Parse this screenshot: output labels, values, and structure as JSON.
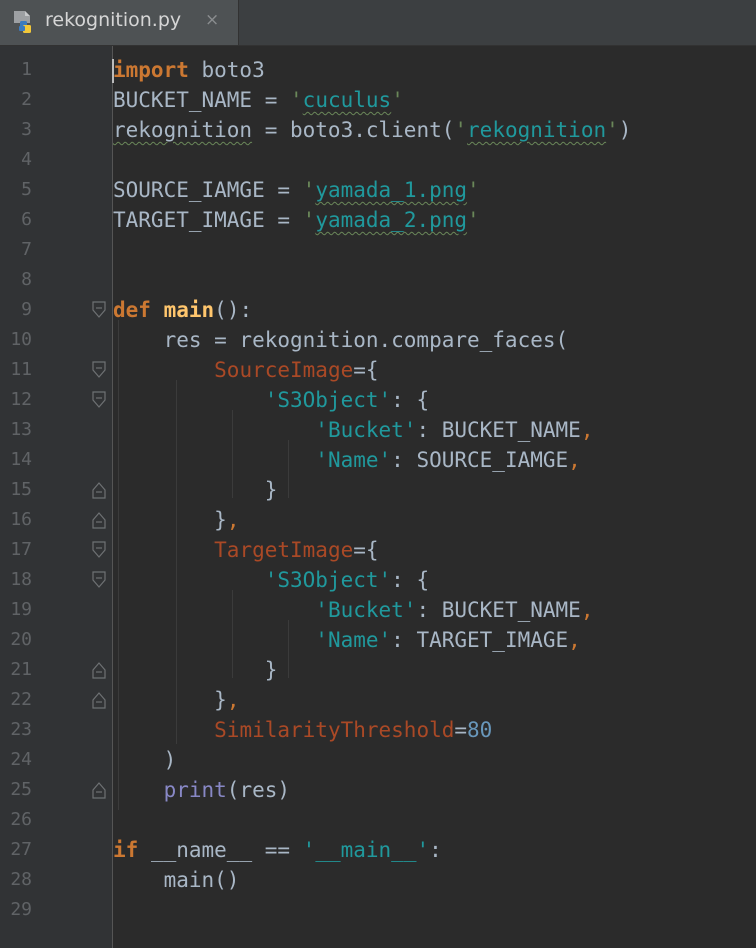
{
  "tab": {
    "filename": "rekognition.py",
    "close_glyph": "×",
    "icon": "python-file-icon"
  },
  "colors": {
    "background": "#2b2b2b",
    "gutter": "#313335",
    "keyword": "#cc7832",
    "string": "#6a8759",
    "parameter": "#aa4926",
    "number": "#6897bb",
    "builtin": "#8888c6",
    "line_number": "#606366",
    "text": "#a9b7c6"
  },
  "gutter": {
    "line_numbers": [
      "1",
      "2",
      "3",
      "4",
      "5",
      "6",
      "7",
      "8",
      "9",
      "10",
      "11",
      "12",
      "13",
      "14",
      "15",
      "16",
      "17",
      "18",
      "19",
      "20",
      "21",
      "22",
      "23",
      "24",
      "25",
      "26",
      "27",
      "28",
      "29"
    ]
  },
  "code": {
    "l1": {
      "kw": "import",
      "rest": " boto3"
    },
    "l2": {
      "name": "BUCKET_NAME",
      "eq": " = ",
      "q1": "'",
      "str": "cuculus",
      "q2": "'"
    },
    "l3": {
      "name": "rekognition",
      "rest": " = boto3.client(",
      "q1": "'",
      "str": "rekognition",
      "q2": "'",
      "close": ")"
    },
    "l5": {
      "name": "SOURCE_IAMGE",
      "eq": " = ",
      "q1": "'",
      "str": "yamada_1.png",
      "q2": "'"
    },
    "l6": {
      "name": "TARGET_IMAGE",
      "eq": " = ",
      "q1": "'",
      "str": "yamada_2.png",
      "q2": "'"
    },
    "l9": {
      "kw": "def",
      "sp": " ",
      "fn": "main",
      "rest": "():"
    },
    "l10": {
      "text": "    res = rekognition.compare_faces("
    },
    "l11": {
      "indent": "        ",
      "param": "SourceImage",
      "rest": "={"
    },
    "l12": {
      "indent": "            ",
      "key": "'S3Object'",
      "rest": ": {"
    },
    "l13": {
      "indent": "                ",
      "key": "'Bucket'",
      "rest": ": BUCKET_NAME",
      "comma": ","
    },
    "l14": {
      "indent": "                ",
      "key": "'Name'",
      "rest": ": SOURCE_IAMGE",
      "comma": ","
    },
    "l15": {
      "text": "            }"
    },
    "l16": {
      "indent": "        ",
      "rest": "}",
      "comma": ","
    },
    "l17": {
      "indent": "        ",
      "param": "TargetImage",
      "rest": "={"
    },
    "l18": {
      "indent": "            ",
      "key": "'S3Object'",
      "rest": ": {"
    },
    "l19": {
      "indent": "                ",
      "key": "'Bucket'",
      "rest": ": BUCKET_NAME",
      "comma": ","
    },
    "l20": {
      "indent": "                ",
      "key": "'Name'",
      "rest": ": TARGET_IMAGE",
      "comma": ","
    },
    "l21": {
      "text": "            }"
    },
    "l22": {
      "indent": "        ",
      "rest": "}",
      "comma": ","
    },
    "l23": {
      "indent": "        ",
      "param": "SimilarityThreshold",
      "eq": "=",
      "num": "80"
    },
    "l24": {
      "text": "    )"
    },
    "l25": {
      "indent": "    ",
      "builtin": "print",
      "rest": "(res)"
    },
    "l27": {
      "kw": "if",
      "rest": " __name__ == ",
      "str": "'__main__'",
      "colon": ":"
    },
    "l28": {
      "text": "    main()"
    }
  }
}
